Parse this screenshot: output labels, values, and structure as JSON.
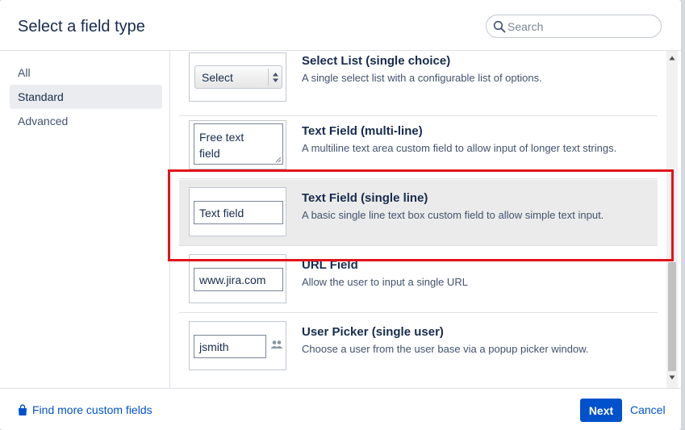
{
  "dialog": {
    "title": "Select a field type",
    "search": {
      "placeholder": "Search",
      "value": ""
    }
  },
  "sidebar": {
    "items": [
      {
        "label": "All",
        "active": false
      },
      {
        "label": "Standard",
        "active": true
      },
      {
        "label": "Advanced",
        "active": false
      }
    ]
  },
  "fields": [
    {
      "title": "Select List (single choice)",
      "description": "A single select list with a configurable list of options.",
      "preview_text": "Select"
    },
    {
      "title": "Text Field (multi-line)",
      "description": "A multiline text area custom field to allow input of longer text strings.",
      "preview_lines": [
        "Free text",
        "field"
      ]
    },
    {
      "title": "Text Field (single line)",
      "description": "A basic single line text box custom field to allow simple text input.",
      "preview_text": "Text field",
      "selected": true
    },
    {
      "title": "URL Field",
      "description": "Allow the user to input a single URL",
      "preview_text": "www.jira.com"
    },
    {
      "title": "User Picker (single user)",
      "description": "Choose a user from the user base via a popup picker window.",
      "preview_text": "jsmith"
    }
  ],
  "footer": {
    "find_more_label": "Find more custom fields",
    "next_label": "Next",
    "cancel_label": "Cancel"
  },
  "colors": {
    "primary": "#0052cc",
    "highlight_border": "#e3141b",
    "selected_row": "#ebebeb"
  }
}
